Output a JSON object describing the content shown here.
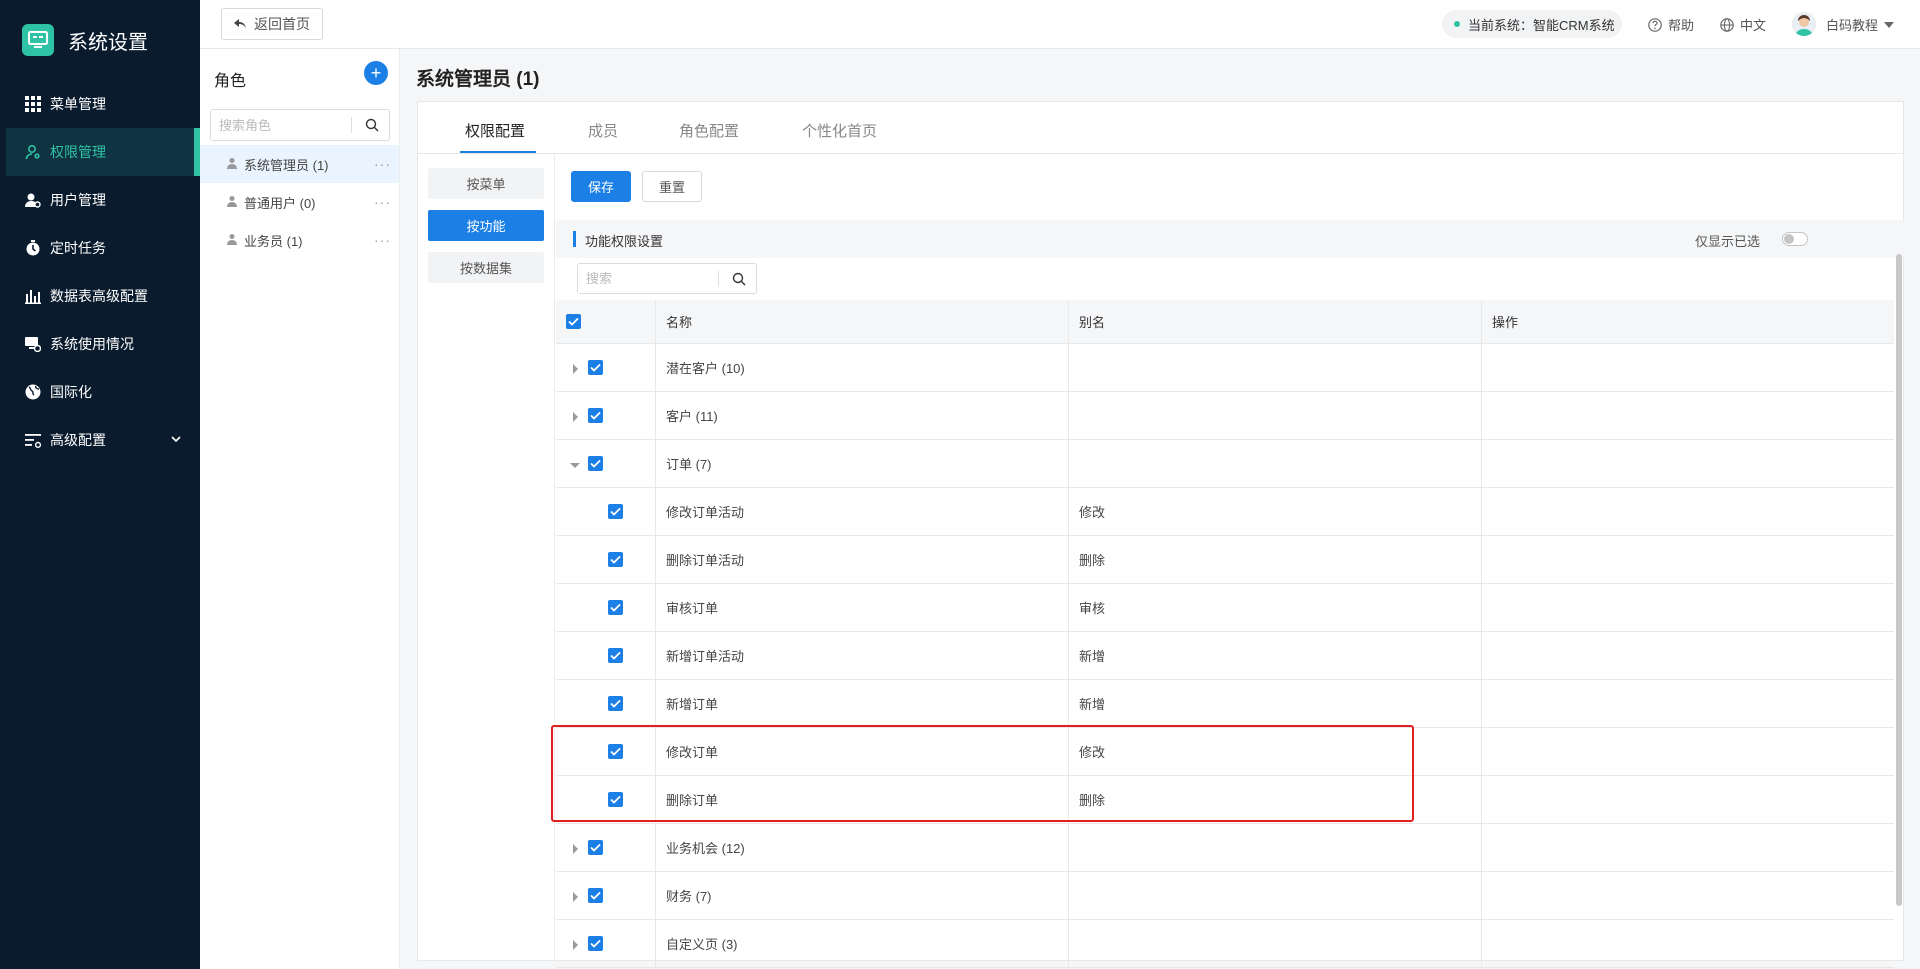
{
  "app": {
    "title": "系统设置"
  },
  "sidebar": {
    "items": [
      {
        "label": "菜单管理",
        "icon": "grid-icon"
      },
      {
        "label": "权限管理",
        "icon": "user-key-icon",
        "active": true
      },
      {
        "label": "用户管理",
        "icon": "user-settings-icon"
      },
      {
        "label": "定时任务",
        "icon": "timer-icon"
      },
      {
        "label": "数据表高级配置",
        "icon": "bar-chart-icon"
      },
      {
        "label": "系统使用情况",
        "icon": "monitor-icon"
      },
      {
        "label": "国际化",
        "icon": "globe-icon"
      },
      {
        "label": "高级配置",
        "icon": "sliders-icon",
        "expandable": true
      }
    ]
  },
  "topbar": {
    "back_label": "返回首页",
    "current_system": "当前系统：智能CRM系统",
    "help": "帮助",
    "language": "中文",
    "user": "白码教程"
  },
  "roles": {
    "heading": "角色",
    "search_placeholder": "搜索角色",
    "items": [
      {
        "label": "系统管理员 (1)",
        "active": true
      },
      {
        "label": "普通用户 (0)"
      },
      {
        "label": "业务员 (1)"
      }
    ]
  },
  "main": {
    "title": "系统管理员 (1)",
    "tabs": [
      "权限配置",
      "成员",
      "角色配置",
      "个性化首页"
    ],
    "active_tab": "权限配置",
    "subnav": [
      "按菜单",
      "按功能",
      "按数据集"
    ],
    "active_subnav": "按功能",
    "save_label": "保存",
    "reset_label": "重置",
    "section_title": "功能权限设置",
    "show_selected_label": "仅显示已选",
    "show_selected_on": false,
    "table_search_placeholder": "搜索",
    "columns": [
      "名称",
      "别名",
      "操作"
    ],
    "rows": [
      {
        "name": "潜在客户 (10)",
        "alias": "",
        "level": 0,
        "expand": "collapsed",
        "checked": true
      },
      {
        "name": "客户 (11)",
        "alias": "",
        "level": 0,
        "expand": "collapsed",
        "checked": true
      },
      {
        "name": "订单 (7)",
        "alias": "",
        "level": 0,
        "expand": "expanded",
        "checked": true
      },
      {
        "name": "修改订单活动",
        "alias": "修改",
        "level": 1,
        "checked": true
      },
      {
        "name": "删除订单活动",
        "alias": "删除",
        "level": 1,
        "checked": true
      },
      {
        "name": "审核订单",
        "alias": "审核",
        "level": 1,
        "checked": true
      },
      {
        "name": "新增订单活动",
        "alias": "新增",
        "level": 1,
        "checked": true
      },
      {
        "name": "新增订单",
        "alias": "新增",
        "level": 1,
        "checked": true
      },
      {
        "name": "修改订单",
        "alias": "修改",
        "level": 1,
        "checked": true
      },
      {
        "name": "删除订单",
        "alias": "删除",
        "level": 1,
        "checked": true
      },
      {
        "name": "业务机会 (12)",
        "alias": "",
        "level": 0,
        "expand": "collapsed",
        "checked": true
      },
      {
        "name": "财务 (7)",
        "alias": "",
        "level": 0,
        "expand": "collapsed",
        "checked": true
      },
      {
        "name": "自定义页 (3)",
        "alias": "",
        "level": 0,
        "expand": "collapsed",
        "checked": true
      }
    ]
  },
  "colors": {
    "sidebar_bg": "#0a1b2e",
    "accent_teal": "#2fc2a4",
    "primary_blue": "#1b7fe6",
    "highlight_red": "#e02020"
  }
}
